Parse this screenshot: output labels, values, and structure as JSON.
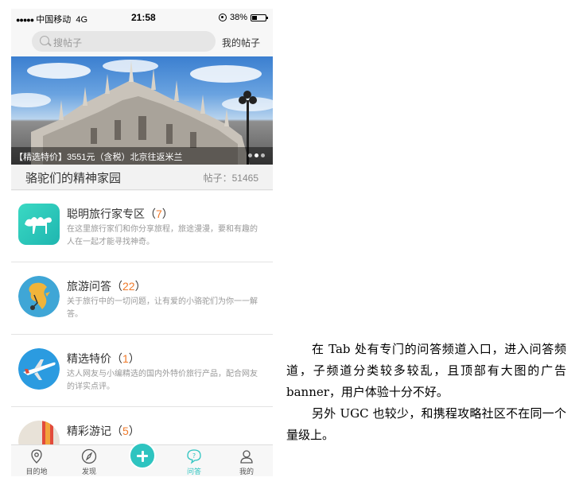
{
  "status_bar": {
    "signal": "●●●●●",
    "carrier": "中国移动",
    "network": "4G",
    "time": "21:58",
    "battery": "38%",
    "battery_level": 0.38
  },
  "search": {
    "placeholder": "搜帖子",
    "my_posts_label": "我的帖子"
  },
  "banner": {
    "caption": "【精选特价】3551元（含税）北京往返米兰",
    "dots": 3,
    "active_dot": 1
  },
  "community": {
    "title": "骆驼们的精神家园",
    "post_count": "帖子：51465"
  },
  "list_items": [
    {
      "title": "聪明旅行家专区（",
      "count": "7",
      "close": "）",
      "desc": "在这里旅行家们和你分享旅程，旅途漫漫，要和有趣的人在一起才能寻找神奇。",
      "icon": "camel-icon"
    },
    {
      "title": "旅游问答（",
      "count": "22",
      "close": "）",
      "desc": "关于旅行中的一切问题，让有爱的小骆驼们为你一一解答。",
      "icon": "globe-icon"
    },
    {
      "title": "精选特价（",
      "count": "1",
      "close": "）",
      "desc": "达人网友与小编精选的国内外特价旅行产品，配合网友的详实点评。",
      "icon": "airplane-icon"
    },
    {
      "title": "精彩游记（",
      "count": "5",
      "close": "）",
      "desc": "",
      "icon": "travelogue-icon"
    }
  ],
  "tabs": [
    {
      "label": "目的地",
      "icon": "location-pin-icon"
    },
    {
      "label": "发现",
      "icon": "compass-icon"
    },
    {
      "label": "",
      "icon": "plus-icon"
    },
    {
      "label": "问答",
      "icon": "question-bubble-icon"
    },
    {
      "label": "我的",
      "icon": "user-icon"
    }
  ],
  "active_tab": "问答",
  "colors": {
    "accent": "#2ec4c0",
    "count": "#f07a2a"
  },
  "commentary": [
    "在 Tab 处有专门的问答频道入口，进入问答频道，子频道分类较多较乱，且顶部有大图的广告 banner，用户体验十分不好。",
    "另外 UGC 也较少，和携程攻略社区不在同一个量级上。"
  ]
}
